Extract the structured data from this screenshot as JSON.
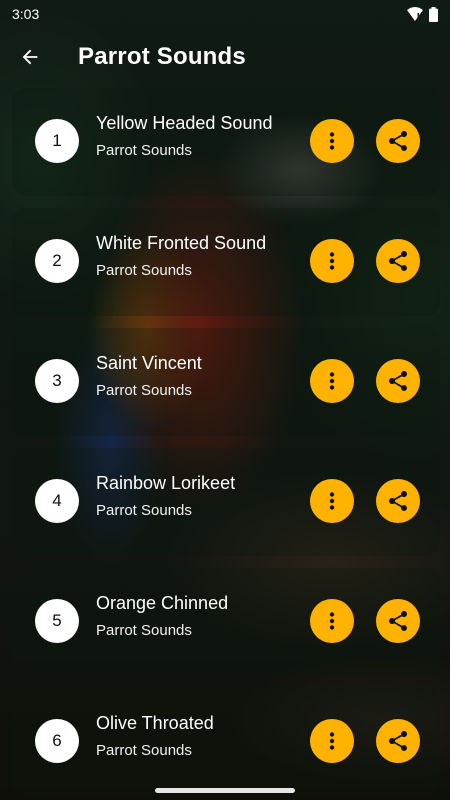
{
  "status_bar": {
    "time": "3:03"
  },
  "app_bar": {
    "title": "Parrot Sounds"
  },
  "colors": {
    "accent": "#FFB300",
    "badge_bg": "#FFFFFF"
  },
  "items": [
    {
      "number": "1",
      "name": "Yellow Headed Sound",
      "subtitle": "Parrot Sounds"
    },
    {
      "number": "2",
      "name": "White Fronted Sound",
      "subtitle": "Parrot Sounds"
    },
    {
      "number": "3",
      "name": "Saint Vincent",
      "subtitle": "Parrot Sounds"
    },
    {
      "number": "4",
      "name": "Rainbow Lorikeet",
      "subtitle": "Parrot Sounds"
    },
    {
      "number": "5",
      "name": "Orange Chinned",
      "subtitle": "Parrot Sounds"
    },
    {
      "number": "6",
      "name": "Olive Throated",
      "subtitle": "Parrot Sounds"
    }
  ],
  "icons": {
    "back": "arrow-left-icon",
    "more": "more-vert-icon",
    "share": "share-icon",
    "wifi": "wifi-icon",
    "battery": "battery-icon"
  }
}
